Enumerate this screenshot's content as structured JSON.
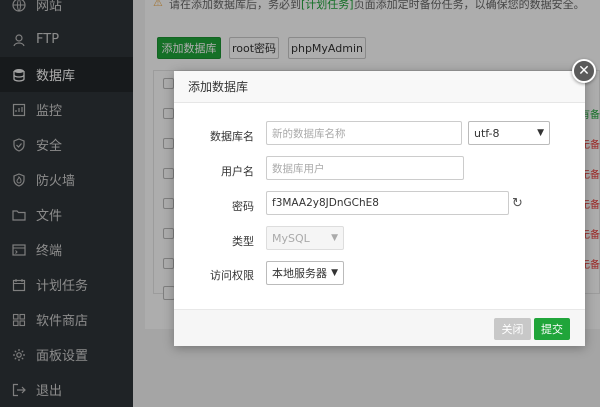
{
  "sidebar": {
    "items": [
      {
        "label": "网站",
        "icon": "globe-icon"
      },
      {
        "label": "FTP",
        "icon": "ftp-icon"
      },
      {
        "label": "数据库",
        "icon": "database-icon",
        "active": true
      },
      {
        "label": "监控",
        "icon": "monitor-icon"
      },
      {
        "label": "安全",
        "icon": "shield-icon"
      },
      {
        "label": "防火墙",
        "icon": "firewall-icon"
      },
      {
        "label": "文件",
        "icon": "folder-icon"
      },
      {
        "label": "终端",
        "icon": "terminal-icon"
      },
      {
        "label": "计划任务",
        "icon": "calendar-icon"
      },
      {
        "label": "软件商店",
        "icon": "store-icon"
      },
      {
        "label": "面板设置",
        "icon": "gear-icon"
      },
      {
        "label": "退出",
        "icon": "logout-icon"
      }
    ]
  },
  "main": {
    "notice_prefix": "请在添加数据库后，务必到",
    "notice_link": "[计划任务]",
    "notice_suffix": "页面添加定时备份任务，以确保您的数据安全。",
    "buttons": {
      "add_db": "添加数据库",
      "root_pwd": "root密码",
      "phpmyadmin": "phpMyAdmin"
    },
    "row_side_labels": [
      "有备",
      "无备",
      "无备",
      "无备",
      "无备",
      "无备"
    ]
  },
  "modal": {
    "title": "添加数据库",
    "fields": {
      "db_name_label": "数据库名",
      "db_name_placeholder": "新的数据库名称",
      "charset": "utf-8",
      "user_label": "用户名",
      "user_placeholder": "数据库用户",
      "password_label": "密码",
      "password_value": "f3MAA2y8JDnGChE8",
      "type_label": "类型",
      "type_value": "MySQL",
      "access_label": "访问权限",
      "access_value": "本地服务器"
    },
    "footer": {
      "close_label": "关闭",
      "submit_label": "提交"
    }
  },
  "colors": {
    "accent": "#20a53a",
    "sidebar_bg": "#2f3438",
    "warning": "#f0ad4e",
    "danger": "#e53935"
  }
}
